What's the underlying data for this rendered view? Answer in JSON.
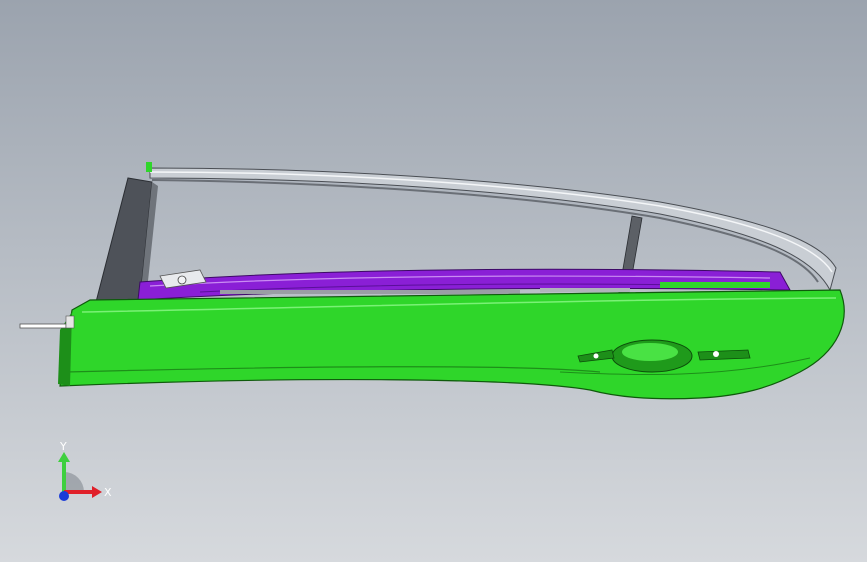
{
  "viewport": {
    "background_top": "#9ba3ae",
    "background_bottom": "#d6d9dd"
  },
  "model": {
    "description_icon": "car-door-assembly",
    "colors": {
      "panel_green": "#2fd62a",
      "panel_green_dark": "#1d8f19",
      "trim_purple": "#8a1fd6",
      "frame_gray": "#5c6066",
      "chrome": "#d9dde2"
    }
  },
  "triad": {
    "x_label": "X",
    "y_label": "Y",
    "x_color": "#e0202a",
    "y_color": "#3ecf3e",
    "z_color": "#1a3cd8"
  }
}
